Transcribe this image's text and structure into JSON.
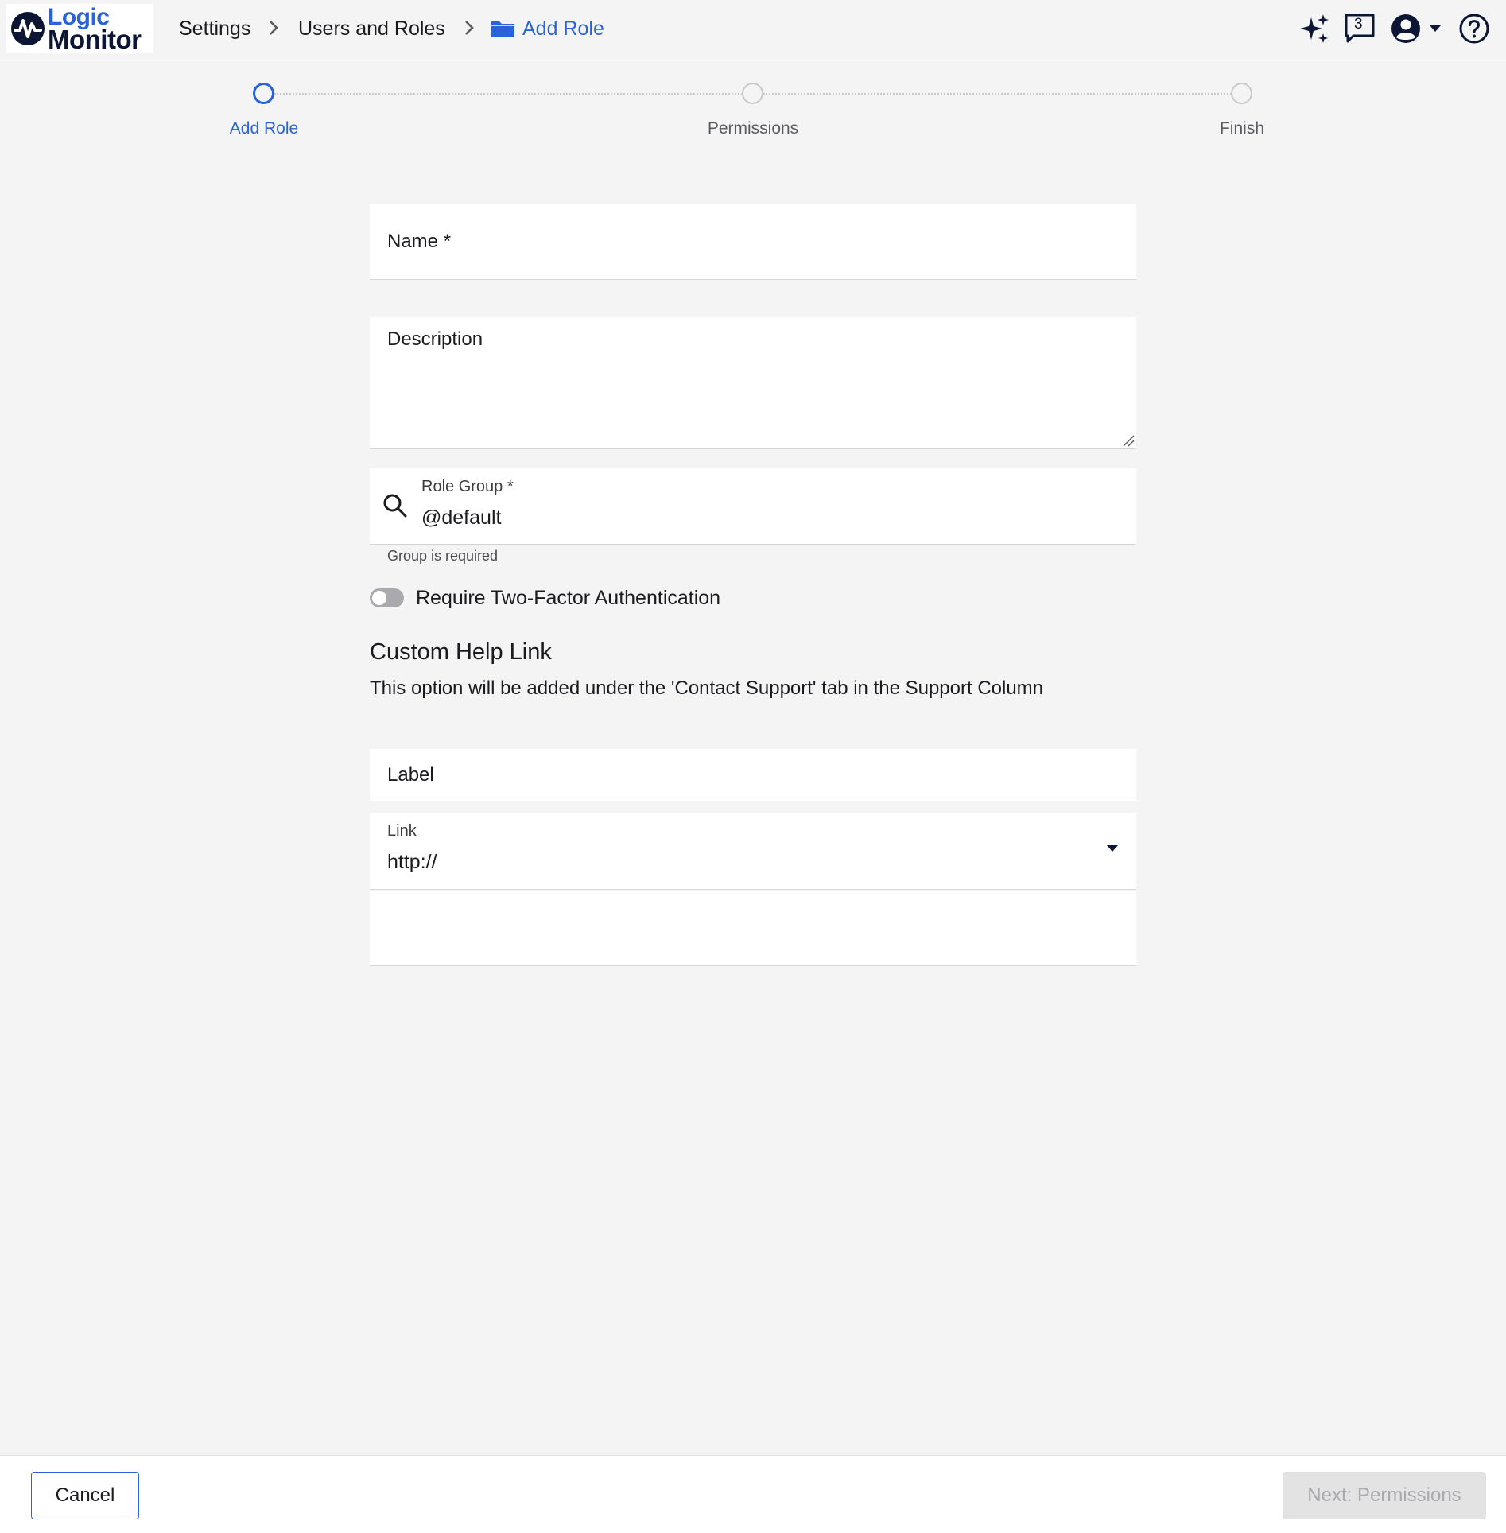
{
  "header": {
    "logo": {
      "line1": "Logic",
      "line2": "Monitor"
    },
    "breadcrumb": [
      {
        "label": "Settings"
      },
      {
        "label": "Users and Roles"
      },
      {
        "label": "Add Role"
      }
    ],
    "notifications_count": "3",
    "icons": [
      "sparkle-icon",
      "chat-icon",
      "user-avatar-icon",
      "caret-down-icon",
      "help-icon"
    ]
  },
  "stepper": {
    "steps": [
      {
        "label": "Add Role",
        "active": true
      },
      {
        "label": "Permissions",
        "active": false
      },
      {
        "label": "Finish",
        "active": false
      }
    ]
  },
  "form": {
    "name_label": "Name *",
    "description_label": "Description",
    "role_group": {
      "label": "Role Group *",
      "value": "@default",
      "helper": "Group is required"
    },
    "two_factor_label": "Require Two-Factor Authentication",
    "two_factor_enabled": false,
    "custom_help": {
      "title": "Custom Help Link",
      "description": "This option will be added under the 'Contact Support' tab in the Support Column"
    },
    "label_field_label": "Label",
    "link": {
      "label": "Link",
      "value": "http://"
    }
  },
  "footer": {
    "cancel_label": "Cancel",
    "next_label": "Next: Permissions"
  },
  "colors": {
    "accent": "#2a63d9",
    "brand_dark": "#0c1634",
    "background": "#f4f4f4"
  }
}
